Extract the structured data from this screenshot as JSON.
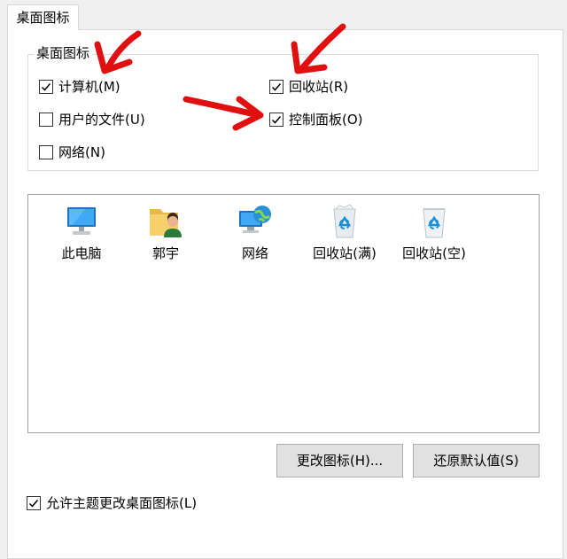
{
  "tab": {
    "label": "桌面图标"
  },
  "group": {
    "title": "桌面图标"
  },
  "checkboxes": [
    {
      "label": "计算机(M)",
      "checked": true
    },
    {
      "label": "用户的文件(U)",
      "checked": false
    },
    {
      "label": "网络(N)",
      "checked": false
    },
    {
      "label": "回收站(R)",
      "checked": true
    },
    {
      "label": "控制面板(O)",
      "checked": true
    }
  ],
  "icons": [
    {
      "label": "此电脑",
      "icon": "computer-icon"
    },
    {
      "label": "郭宇",
      "icon": "user-folder-icon"
    },
    {
      "label": "网络",
      "icon": "network-icon"
    },
    {
      "label": "回收站(满)",
      "icon": "recycle-bin-full-icon"
    },
    {
      "label": "回收站(空)",
      "icon": "recycle-bin-empty-icon"
    }
  ],
  "buttons": {
    "change_icon": "更改图标(H)...",
    "restore_default": "还原默认值(S)"
  },
  "allow_themes": {
    "label": "允许主题更改桌面图标(L)",
    "checked": true
  },
  "colors": {
    "annotation_arrow": "#e01010",
    "accent": "#1a8fd6"
  }
}
